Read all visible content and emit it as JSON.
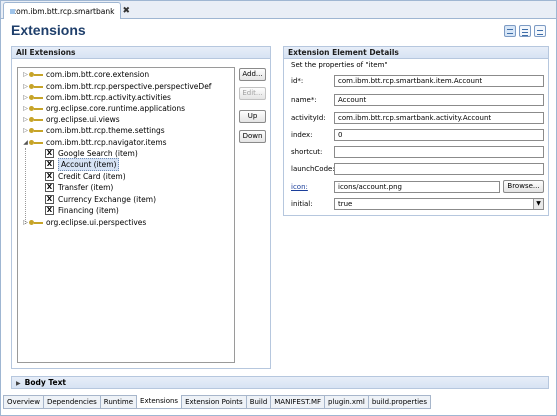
{
  "editor_tab": {
    "title": "com.ibm.btt.rcp.smartbank",
    "close": "✖"
  },
  "page_title": "Extensions",
  "left": {
    "title": "All Extensions",
    "tree": [
      "com.ibm.btt.core.extension",
      "com.ibm.btt.rcp.perspective.perspectiveDef",
      "com.ibm.btt.rcp.activity.activities",
      "org.eclipse.core.runtime.applications",
      "org.eclipse.ui.views",
      "com.ibm.btt.rcp.theme.settings",
      "com.ibm.btt.rcp.navigator.items"
    ],
    "items": [
      "Google Search (item)",
      "Account (item)",
      "Credit Card (item)",
      "Transfer (item)",
      "Currency Exchange (item)",
      "Financing (item)"
    ],
    "last": "org.eclipse.ui.perspectives"
  },
  "buttons": {
    "add": "Add...",
    "edit": "Edit...",
    "up": "Up",
    "down": "Down"
  },
  "details": {
    "title": "Extension Element Details",
    "subtitle": "Set the properties of \"item\"",
    "fields": {
      "id_label": "id*:",
      "id_value": "com.ibm.btt.rcp.smartbank.item.Account",
      "name_label": "name*:",
      "name_value": "Account",
      "activity_label": "activityId:",
      "activity_value": "com.ibm.btt.rcp.smartbank.activity.Account",
      "index_label": "index:",
      "index_value": "0",
      "shortcut_label": "shortcut:",
      "shortcut_value": "",
      "launch_label": "launchCode:",
      "launch_value": "",
      "icon_label": "icon:",
      "icon_value": "icons/account.png",
      "browse": "Browse...",
      "initial_label": "initial:",
      "initial_value": "true"
    }
  },
  "body_text": "Body Text",
  "bottom_tabs": [
    "Overview",
    "Dependencies",
    "Runtime",
    "Extensions",
    "Extension Points",
    "Build",
    "MANIFEST.MF",
    "plugin.xml",
    "build.properties"
  ]
}
